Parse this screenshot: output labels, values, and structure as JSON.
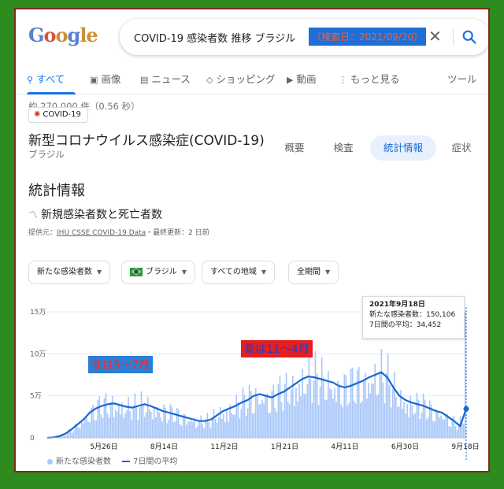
{
  "search": {
    "query": "COVID-19 感染者数 推移 ブラジル",
    "highlight": "（検索日：2021/09/20）"
  },
  "tabs": [
    {
      "label": "すべて",
      "icon": "search-icon"
    },
    {
      "label": "画像",
      "icon": "image-icon"
    },
    {
      "label": "ニュース",
      "icon": "news-icon"
    },
    {
      "label": "ショッピング",
      "icon": "tag-icon"
    },
    {
      "label": "動画",
      "icon": "play-icon"
    },
    {
      "label": "もっと見る",
      "icon": "more-vertical-icon"
    },
    {
      "label": "ツール",
      "icon": ""
    }
  ],
  "result_count": "約 270,000 件（0.56 秒）",
  "badge": "COVID-19",
  "topic": {
    "title": "新型コロナウイルス感染症(COVID-19)",
    "country": "ブラジル",
    "pills": [
      "概要",
      "検査",
      "統計情報",
      "症状"
    ]
  },
  "section_title": "統計情報",
  "metric_title": "新規感染者数と死亡者数",
  "source": {
    "prefix": "提供元：",
    "link": "JHU CSSE COVID-19 Data",
    "updated": "・最終更新：2 日前"
  },
  "filters": [
    "新たな感染者数",
    "ブラジル",
    "すべての地域",
    "全期間"
  ],
  "tooltip": {
    "date": "2021年9月18日",
    "new_cases": "新たな感染者数：150,106",
    "avg": "7日間の平均：34,452"
  },
  "notes": {
    "winter": "冬は5〜7月",
    "summer": "夏は11〜4月"
  },
  "legend": {
    "bars": "新たな感染者数",
    "line": "7日間の平均"
  },
  "colors": {
    "accent": "#1a73e8",
    "bars": "#a8c7fa",
    "line": "#1967d2"
  },
  "chart_data": {
    "type": "bar",
    "y_ticks": [
      "15万",
      "10万",
      "5万",
      "0"
    ],
    "ylim": [
      0,
      150000
    ],
    "x_ticks": [
      "5月26日",
      "8月14日",
      "11月2日",
      "1月21日",
      "4月11日",
      "6月30日",
      "9月18日"
    ],
    "series": [
      {
        "name": "新たな感染者数"
      },
      {
        "name": "7日間の平均"
      }
    ],
    "avg_weekly": [
      0,
      500,
      2000,
      5000,
      10000,
      16000,
      22000,
      30000,
      35000,
      38000,
      40000,
      41000,
      39000,
      37000,
      36000,
      38000,
      40000,
      38000,
      35000,
      32000,
      30000,
      28000,
      26000,
      24000,
      22000,
      20000,
      20000,
      22000,
      27000,
      32000,
      35000,
      38000,
      42000,
      45000,
      50000,
      52000,
      50000,
      48000,
      52000,
      55000,
      60000,
      65000,
      70000,
      73000,
      72000,
      70000,
      68000,
      66000,
      62000,
      60000,
      62000,
      65000,
      68000,
      72000,
      75000,
      78000,
      72000,
      60000,
      50000,
      45000,
      42000,
      40000,
      38000,
      35000,
      32000,
      30000,
      25000,
      20000,
      14000,
      34452
    ],
    "highlight": {
      "date": "9月18日",
      "value": 150106,
      "avg": 34452
    }
  }
}
